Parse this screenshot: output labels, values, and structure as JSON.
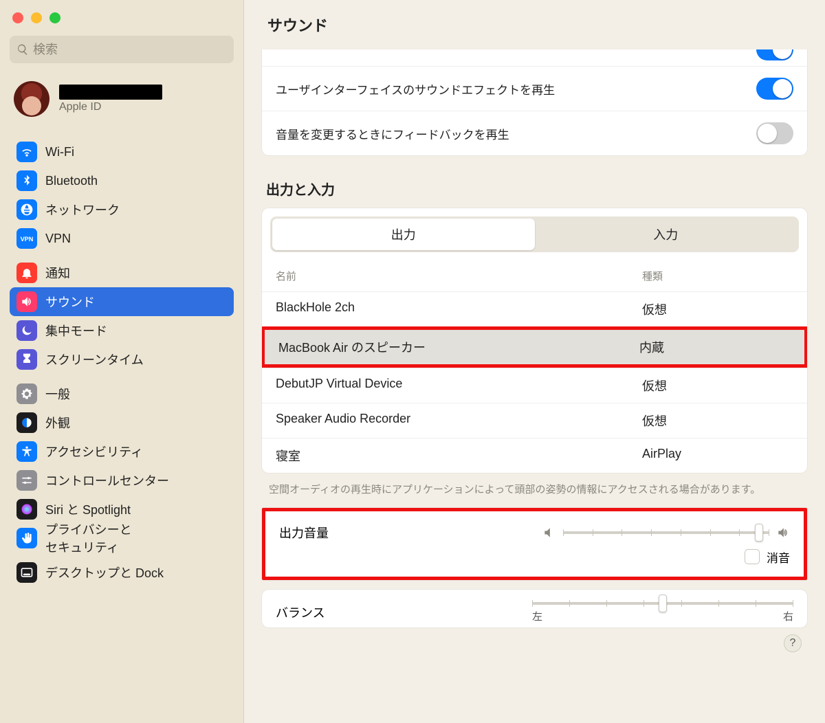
{
  "window": {
    "title": "サウンド"
  },
  "search": {
    "placeholder": "検索"
  },
  "account": {
    "subtitle": "Apple ID"
  },
  "sidebar": {
    "groups": [
      {
        "items": [
          {
            "label": "Wi-Fi",
            "icon": "wifi",
            "bg": "#0a7aff"
          },
          {
            "label": "Bluetooth",
            "icon": "bluetooth",
            "bg": "#0a7aff"
          },
          {
            "label": "ネットワーク",
            "icon": "globe",
            "bg": "#0a7aff"
          },
          {
            "label": "VPN",
            "icon": "vpn",
            "bg": "#0a7aff"
          }
        ]
      },
      {
        "items": [
          {
            "label": "通知",
            "icon": "bell",
            "bg": "#ff3b30"
          },
          {
            "label": "サウンド",
            "icon": "sound",
            "bg": "#ff3b6b",
            "selected": true
          },
          {
            "label": "集中モード",
            "icon": "moon",
            "bg": "#5856d6"
          },
          {
            "label": "スクリーンタイム",
            "icon": "hourglass",
            "bg": "#5856d6"
          }
        ]
      },
      {
        "items": [
          {
            "label": "一般",
            "icon": "gear",
            "bg": "#8e8e93"
          },
          {
            "label": "外観",
            "icon": "appearance",
            "bg": "#1c1c1e"
          },
          {
            "label": "アクセシビリティ",
            "icon": "accessibility",
            "bg": "#0a7aff"
          },
          {
            "label": "コントロールセンター",
            "icon": "sliders",
            "bg": "#8e8e93"
          },
          {
            "label": "Siri と Spotlight",
            "icon": "siri",
            "bg": "#1c1c1e"
          },
          {
            "label": "プライバシーと\nセキュリティ",
            "icon": "hand",
            "bg": "#0a7aff"
          }
        ]
      },
      {
        "items": [
          {
            "label": "デスクトップと Dock",
            "icon": "dock",
            "bg": "#1c1c1e"
          }
        ]
      }
    ]
  },
  "effects": {
    "rows": [
      {
        "label": "ユーザインターフェイスのサウンドエフェクトを再生",
        "on": true
      },
      {
        "label": "音量を変更するときにフィードバックを再生",
        "on": false
      }
    ]
  },
  "io": {
    "title": "出力と入力",
    "tabs": {
      "output": "出力",
      "input": "入力",
      "active": "output"
    },
    "columns": {
      "name": "名前",
      "type": "種類"
    },
    "devices": [
      {
        "name": "BlackHole 2ch",
        "type": "仮想"
      },
      {
        "name": "MacBook Air のスピーカー",
        "type": "内蔵",
        "selected": true,
        "highlight": true
      },
      {
        "name": "DebutJP Virtual Device",
        "type": "仮想"
      },
      {
        "name": "Speaker Audio Recorder",
        "type": "仮想"
      },
      {
        "name": "寝室",
        "type": "AirPlay"
      }
    ],
    "note": "空間オーディオの再生時にアプリケーションによって頭部の姿勢の情報にアクセスされる場合があります。"
  },
  "volume": {
    "label": "出力音量",
    "percent": 95,
    "mute_label": "消音",
    "muted": false
  },
  "balance": {
    "label": "バランス",
    "percent": 50,
    "left": "左",
    "right": "右"
  }
}
